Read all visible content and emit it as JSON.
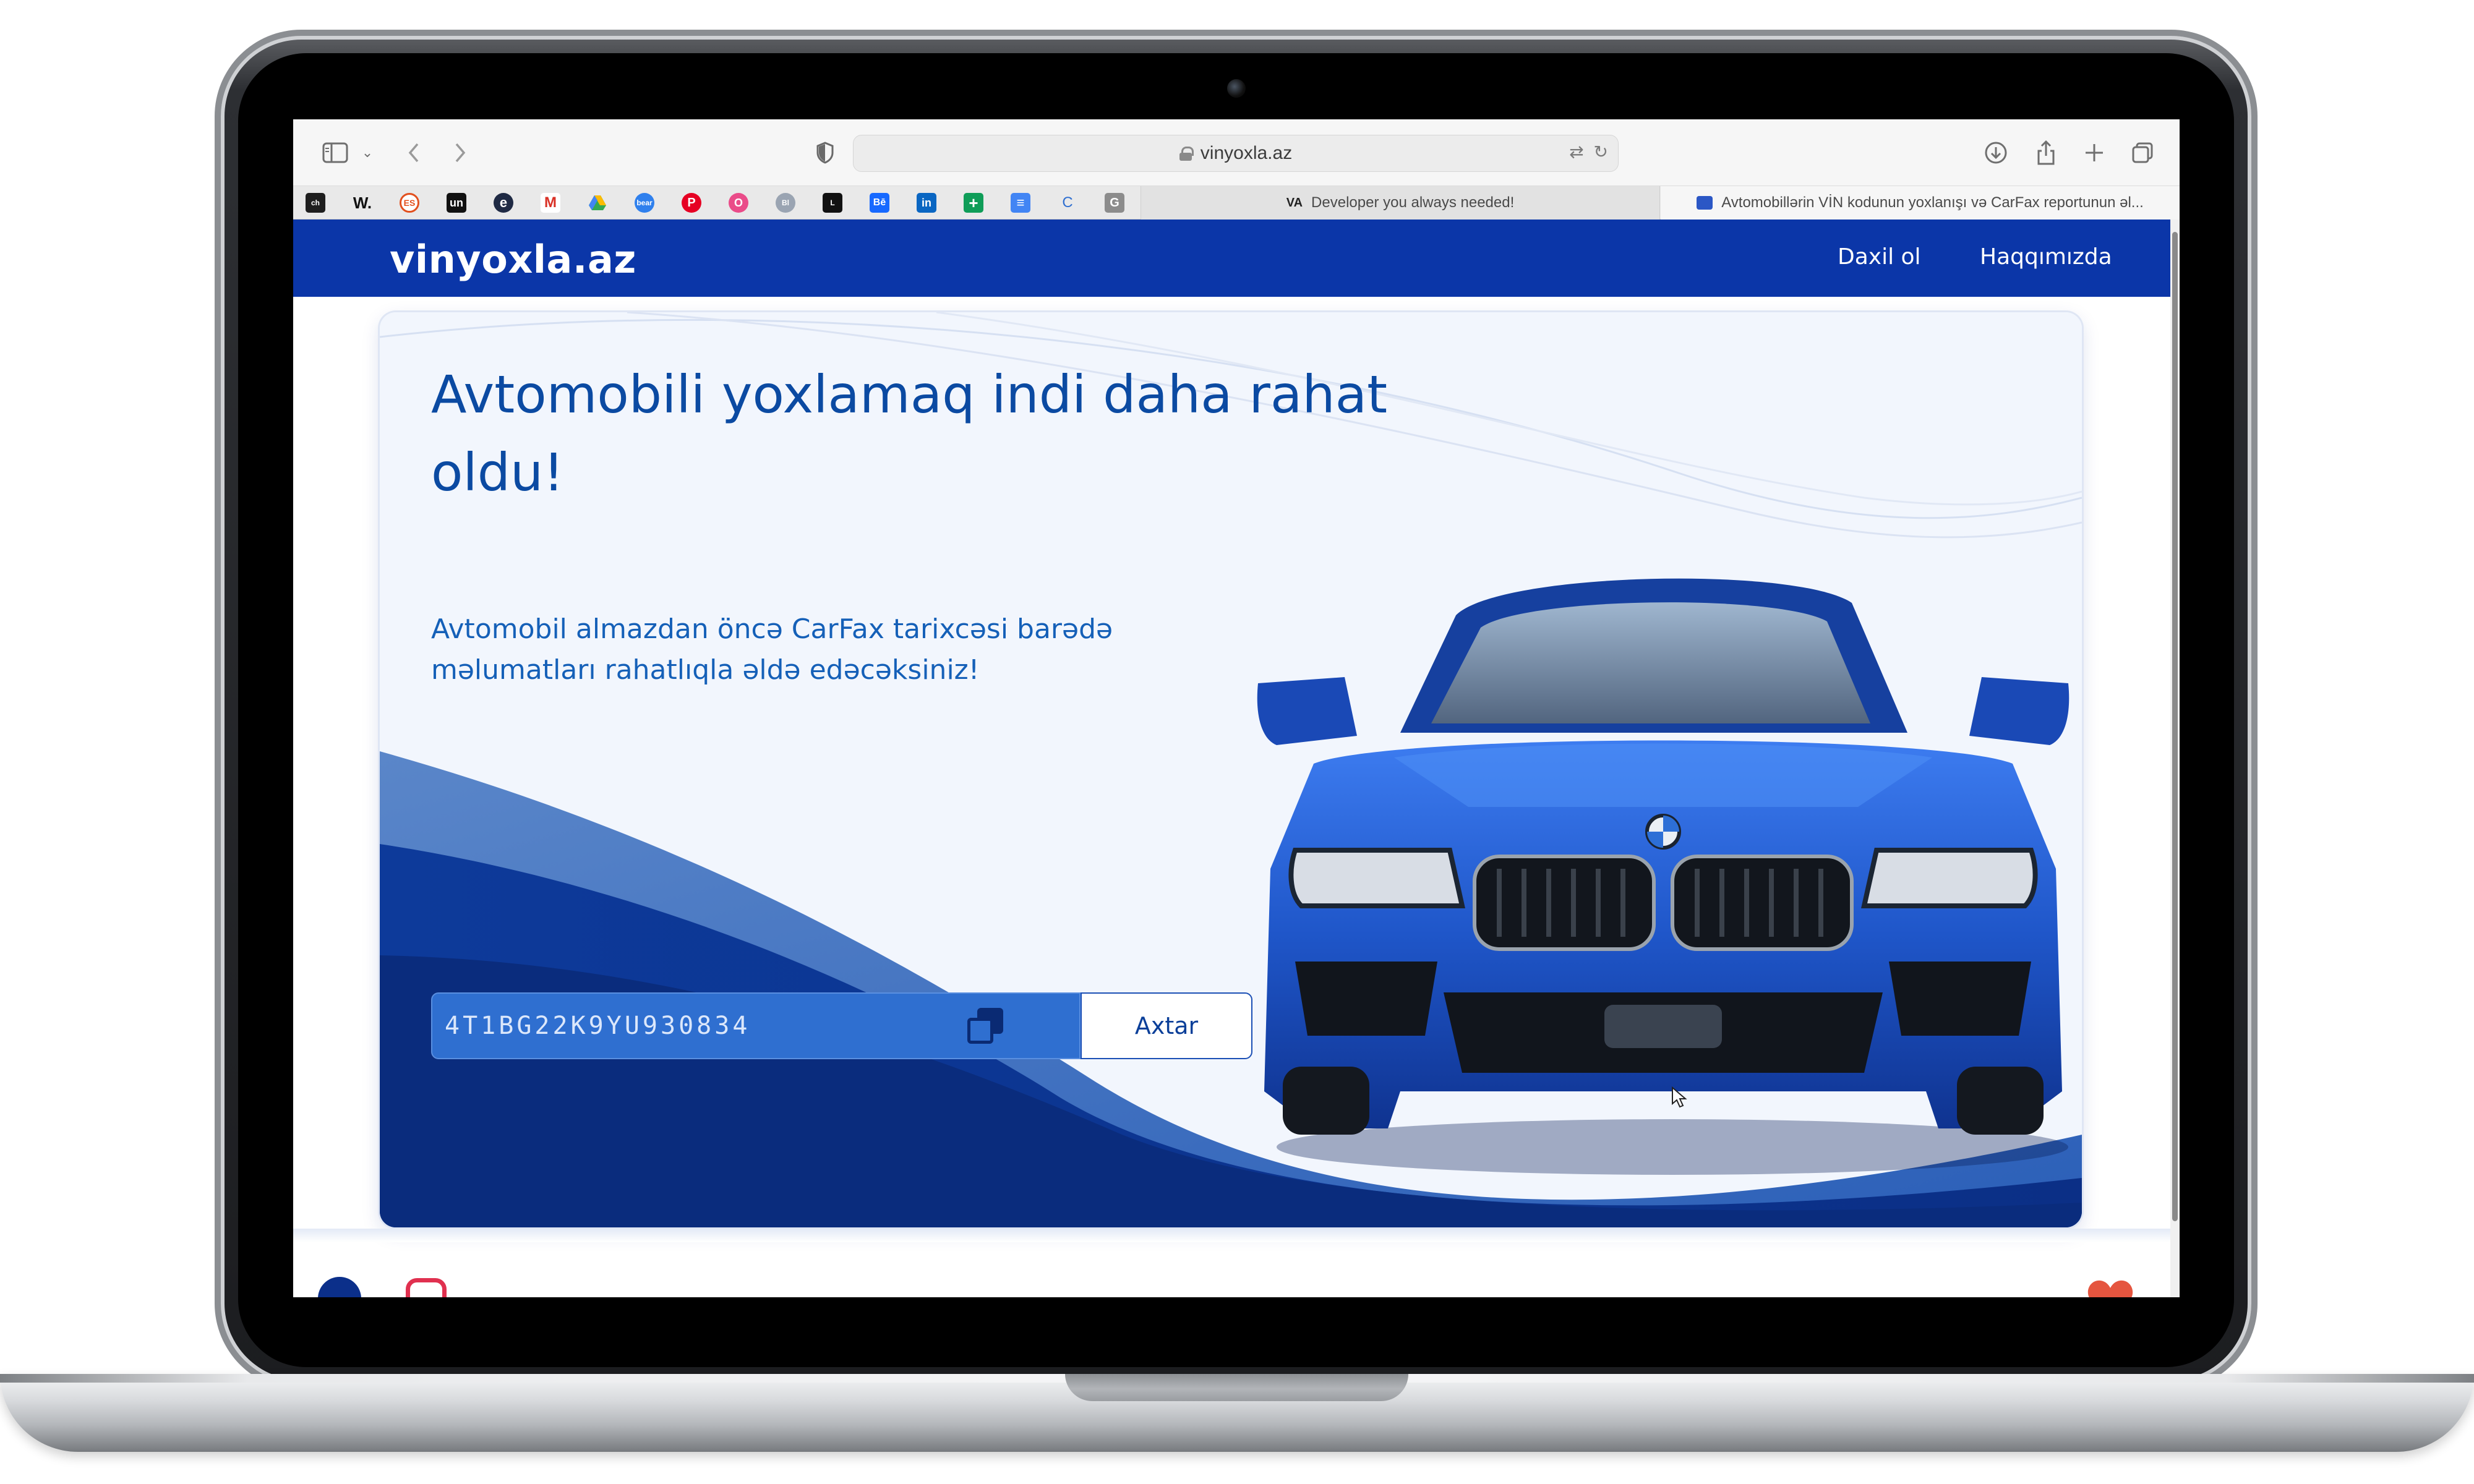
{
  "browser": {
    "url": "vinyoxla.az",
    "tabs": [
      {
        "label": "Developer you always needed!",
        "icon": "VA"
      },
      {
        "label": "Avtomobillərin VİN kodunun yoxlanışı və CarFax reportunun əl...",
        "icon": "car-favicon"
      }
    ],
    "favorites": [
      "ch",
      "W.",
      "ES",
      "un",
      "e",
      "M",
      "drive",
      "bear",
      "P",
      "O",
      "Bl",
      "L",
      "Bē",
      "in",
      "+",
      "≡",
      "C",
      "G"
    ]
  },
  "site": {
    "logo": "vinyoxla.az",
    "nav": {
      "login": "Daxil ol",
      "about": "Haqqımızda"
    },
    "hero": {
      "title": "Avtomobili yoxlamaq indi daha rahat oldu!",
      "subtitle": "Avtomobil almazdan öncə CarFax tarixcəsi barədə məlumatları rahatlıqla əldə edəcəksiniz!",
      "vin_value": "4T1BG22K9YU930834",
      "search_label": "Axtar"
    }
  },
  "colors": {
    "brand_blue": "#0b36a8",
    "title_blue": "#0b4aa2",
    "input_blue": "#2f6fd0",
    "car_blue": "#1e5bd0"
  }
}
